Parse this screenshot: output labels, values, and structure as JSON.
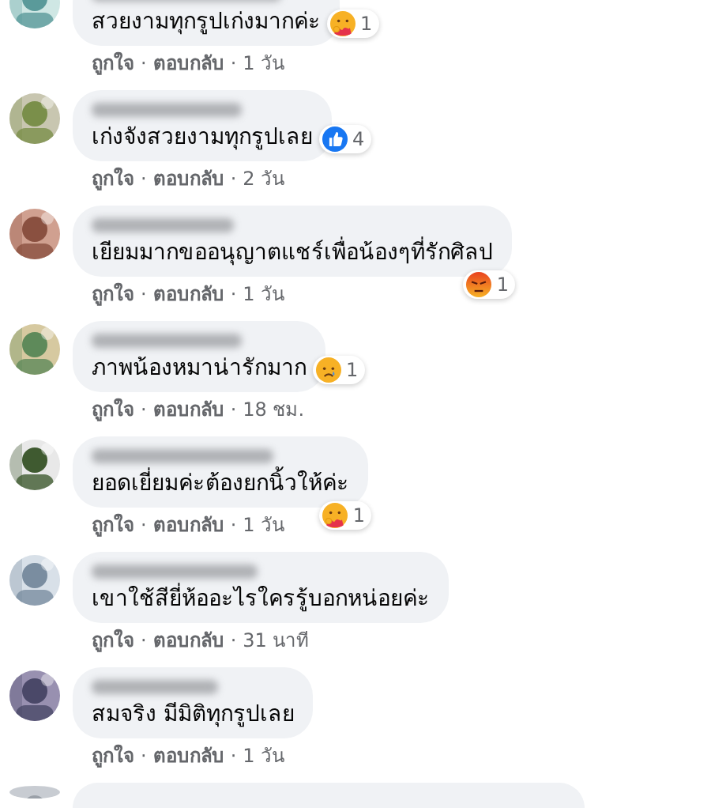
{
  "separator": "·",
  "comments": [
    {
      "text": "สวยงามทุกรูปเก่งมากค่ะ",
      "reaction": {
        "kind": "care",
        "count": "1",
        "below_bubble": false
      },
      "like": "ถูกใจ",
      "reply": "ตอบกลับ",
      "time": "1 วัน"
    },
    {
      "text": "เก่งจังสวยงามทุกรูปเลย",
      "reaction": {
        "kind": "like",
        "count": "4",
        "below_bubble": false
      },
      "like": "ถูกใจ",
      "reply": "ตอบกลับ",
      "time": "2 วัน"
    },
    {
      "text": "เยียมมากขออนุญาตแชร์เพื่อน้องๆที่รักศิลป",
      "reaction": {
        "kind": "angry",
        "count": "1",
        "below_bubble": true
      },
      "like": "ถูกใจ",
      "reply": "ตอบกลับ",
      "time": "1 วัน"
    },
    {
      "text": "ภาพน้องหมาน่ารักมาก",
      "reaction": {
        "kind": "sad",
        "count": "1",
        "below_bubble": false
      },
      "like": "ถูกใจ",
      "reply": "ตอบกลับ",
      "time": "18 ชม."
    },
    {
      "text": "ยอดเยี่ยมค่ะต้องยกนิ้วให้ค่ะ",
      "reaction": {
        "kind": "care",
        "count": "1",
        "below_bubble": true
      },
      "like": "ถูกใจ",
      "reply": "ตอบกลับ",
      "time": "1 วัน"
    },
    {
      "text": "เขาใช้สียี่ห้ออะไรใครรู้บอกหน่อยค่ะ",
      "like": "ถูกใจ",
      "reply": "ตอบกลับ",
      "time": "31 นาที"
    },
    {
      "text": "สมจริง มีมิติทุกรูปเลย",
      "like": "ถูกใจ",
      "reply": "ตอบกลับ",
      "time": "1 วัน"
    }
  ]
}
